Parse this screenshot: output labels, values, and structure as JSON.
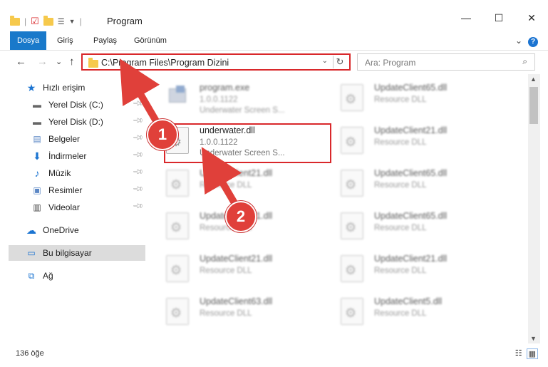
{
  "window": {
    "title": "Program",
    "minimize": "—",
    "maximize": "☐",
    "close": "✕"
  },
  "ribbon": {
    "tabs": [
      "Dosya",
      "Giriş",
      "Paylaş",
      "Görünüm"
    ],
    "help": "?"
  },
  "address": {
    "path": "C:\\Program Files\\Program Dizini",
    "dropdown": "⌄",
    "refresh": "↻"
  },
  "search": {
    "placeholder": "Ara: Program",
    "icon": "⌕"
  },
  "nav": {
    "back": "←",
    "forward": "→",
    "recent": "⌄",
    "up": "↑"
  },
  "sidebar": {
    "items": [
      {
        "label": "Hızlı erişim",
        "icon": "star-icon",
        "pinned": false
      },
      {
        "label": "Yerel Disk (C:)",
        "icon": "drive-icon",
        "pinned": true
      },
      {
        "label": "Yerel Disk (D:)",
        "icon": "drive-icon",
        "pinned": true
      },
      {
        "label": "Belgeler",
        "icon": "documents-icon",
        "pinned": true
      },
      {
        "label": "İndirmeler",
        "icon": "download-icon",
        "pinned": true
      },
      {
        "label": "Müzik",
        "icon": "music-icon",
        "pinned": true
      },
      {
        "label": "Resimler",
        "icon": "pictures-icon",
        "pinned": true
      },
      {
        "label": "Videolar",
        "icon": "video-icon",
        "pinned": true
      },
      {
        "label": "OneDrive",
        "icon": "cloud-icon",
        "pinned": false
      },
      {
        "label": "Bu bilgisayar",
        "icon": "computer-icon",
        "pinned": false,
        "selected": true
      },
      {
        "label": "Ağ",
        "icon": "network-icon",
        "pinned": false
      }
    ]
  },
  "files": [
    {
      "name": "program.exe",
      "line2": "1.0.0.1122",
      "line3": "Underwater Screen S...",
      "type": "exe"
    },
    {
      "name": "UpdateClient65.dll",
      "line2": "Resource DLL",
      "line3": "",
      "type": "dll"
    },
    {
      "name": "underwater.dll",
      "line2": "1.0.0.1122",
      "line3": "Underwater Screen S...",
      "type": "dll",
      "highlight": true
    },
    {
      "name": "UpdateClient21.dll",
      "line2": "Resource DLL",
      "line3": "",
      "type": "dll"
    },
    {
      "name": "UpdateClient21.dll",
      "line2": "Resource DLL",
      "line3": "",
      "type": "dll"
    },
    {
      "name": "UpdateClient65.dll",
      "line2": "Resource DLL",
      "line3": "",
      "type": "dll"
    },
    {
      "name": "UpdateClient21.dll",
      "line2": "Resource DLL",
      "line3": "",
      "type": "dll"
    },
    {
      "name": "UpdateClient65.dll",
      "line2": "Resource DLL",
      "line3": "",
      "type": "dll"
    },
    {
      "name": "UpdateClient21.dll",
      "line2": "Resource DLL",
      "line3": "",
      "type": "dll"
    },
    {
      "name": "UpdateClient21.dll",
      "line2": "Resource DLL",
      "line3": "",
      "type": "dll"
    },
    {
      "name": "UpdateClient63.dll",
      "line2": "Resource DLL",
      "line3": "",
      "type": "dll"
    },
    {
      "name": "UpdateClient5.dll",
      "line2": "Resource DLL",
      "line3": "",
      "type": "dll"
    }
  ],
  "status": {
    "count": "136 öğe"
  },
  "annotations": {
    "step1": "1",
    "step2": "2",
    "color": "#e0403a"
  }
}
